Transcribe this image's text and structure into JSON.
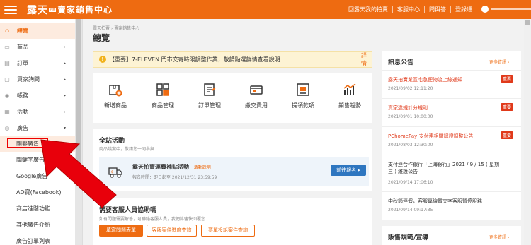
{
  "header": {
    "brand_logo": "露天",
    "brand_tag": "拍賣",
    "brand_title": "賣家銷售中心",
    "links": [
      "回露天我的拍賣",
      "客服中心",
      "問與答",
      "登錄通"
    ]
  },
  "sidebar": {
    "items": [
      {
        "label": "總覽",
        "icon": "home-icon"
      },
      {
        "label": "商品",
        "icon": "box-icon"
      },
      {
        "label": "訂單",
        "icon": "order-icon"
      },
      {
        "label": "買家詢問",
        "icon": "chat-icon"
      },
      {
        "label": "帳務",
        "icon": "dollar-icon"
      },
      {
        "label": "活動",
        "icon": "calendar-icon"
      },
      {
        "label": "廣告",
        "icon": "megaphone-icon"
      }
    ],
    "ads_submenu": [
      "關聯廣告",
      "關鍵字廣告",
      "Google廣告",
      "AD寶(Facebook)",
      "商店進階功能",
      "其他廣告介紹",
      "廣告訂單列表"
    ]
  },
  "main": {
    "breadcrumb": "露天拍賣 › 賣家銷售中心",
    "title": "總覽",
    "notice": {
      "text": "【重要】7-ELEVEN 門市交寄時限調整作業，敬請點選詳情查看說明",
      "more": "詳情"
    },
    "quick_actions": [
      "新增商品",
      "商品管理",
      "訂單管理",
      "繳交費用",
      "提領款項",
      "銷售趨勢"
    ],
    "campaign": {
      "title": "全站活動",
      "subtitle": "商品議案中，敬請您一同參與",
      "card_title": "露天拍賣運費補貼活動",
      "card_rule": "活動說明",
      "card_time": "報名時間：即日起至 2021/12/31 23:59:59",
      "cta": "前往報名 ▸"
    },
    "support": {
      "title": "需要客服人員協助嗎",
      "subtitle": "如有問題需要解答，可聯絡客服人員，我們將儘快回覆您",
      "buttons": [
        "填寫問題表單",
        "客服案件進度查詢",
        "票單投訴案件查詢"
      ]
    }
  },
  "right": {
    "title": "訊息公告",
    "more": "更多資訊 ›",
    "news": [
      {
        "title": "露天拍賣業區宅急便物流上線通知",
        "date": "2021/09/02 12:11:20",
        "badge": "重要",
        "alert": true
      },
      {
        "title": "賣家違規計分規則",
        "date": "2021/09/01 10:00:00",
        "badge": "重要",
        "alert": true
      },
      {
        "title": "PChomePay 支付連相關認證調整公告",
        "date": "2021/08/03 12:30:00",
        "badge": "重要",
        "alert": true
      },
      {
        "title": "支付連合作銀行「上海銀行」2021 / 9 / 15 ( 星期三 ) 維護公告",
        "date": "2021/09/14 17:06:10",
        "badge": "",
        "alert": false
      },
      {
        "title": "中秋節連假，客服專線暨文字客服暫停服務",
        "date": "2021/09/14 09:17:35",
        "badge": "",
        "alert": false
      }
    ],
    "sales_title": "販售規範/宣導",
    "sales_more": "更多資訊 ›"
  }
}
